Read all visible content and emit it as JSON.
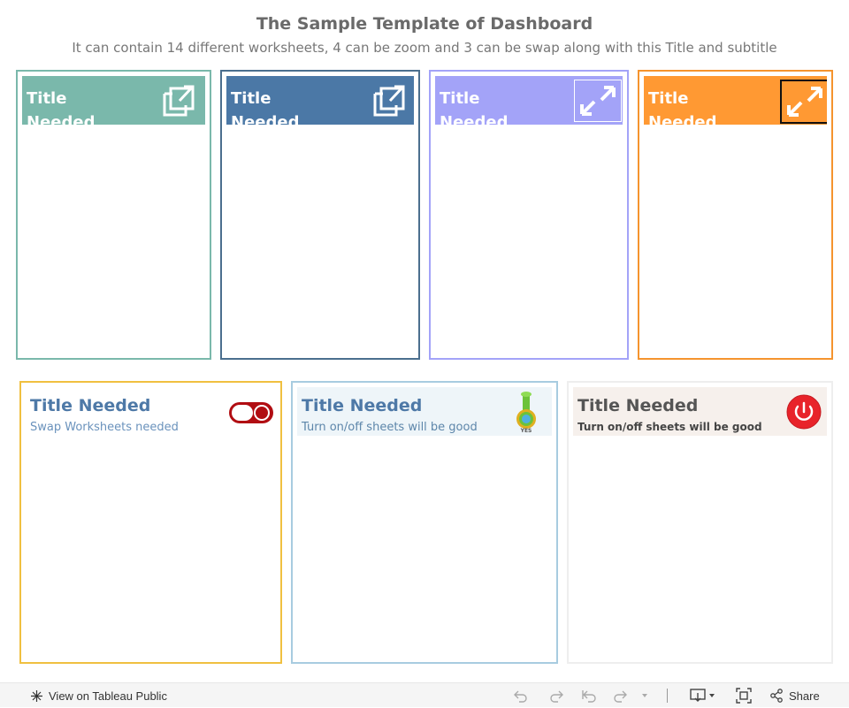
{
  "header": {
    "title": "The Sample Template of Dashboard",
    "subtitle": "It can contain 14 different worksheets, 4 can be zoom and 3 can be swap along with this Title and subtitle"
  },
  "top_cards": [
    {
      "title": "Title Needed",
      "icon": "external-link-icon",
      "accent": "#7ab8ab",
      "border": "#7ab8ab"
    },
    {
      "title": "Title Needed",
      "icon": "external-link-icon",
      "accent": "#4b78a6",
      "border": "#4b6f8e"
    },
    {
      "title": "Title Needed",
      "icon": "expand-arrows-icon",
      "accent": "#a3a3f8",
      "border": "#a3a3f8"
    },
    {
      "title": "Title Needed",
      "icon": "expand-arrows-icon",
      "accent": "#ff9933",
      "border": "#f5942e"
    }
  ],
  "bottom_cards": [
    {
      "title": "Title Needed",
      "subtitle": "Swap Worksheets needed",
      "icon": "toggle-switch-icon",
      "border": "#f0c040",
      "title_color": "#4e79a7",
      "subtitle_color": "#6a92bc"
    },
    {
      "title": "Title Needed",
      "subtitle": "Turn on/off sheets will be good",
      "icon": "lever-switch-icon",
      "icon_label": "YES",
      "border": "#a8cce0",
      "header_bg": "#eef5f9",
      "title_color": "#4e79a7",
      "subtitle_color": "#5d86aa"
    },
    {
      "title": "Title Needed",
      "subtitle": "Turn on/off sheets will be good",
      "icon": "power-button-icon",
      "border": "#eeeeee",
      "header_bg": "#f6f0ec",
      "title_color": "#555555",
      "subtitle_color": "#444444"
    }
  ],
  "footer": {
    "view_label": "View on Tableau Public",
    "share_label": "Share"
  }
}
